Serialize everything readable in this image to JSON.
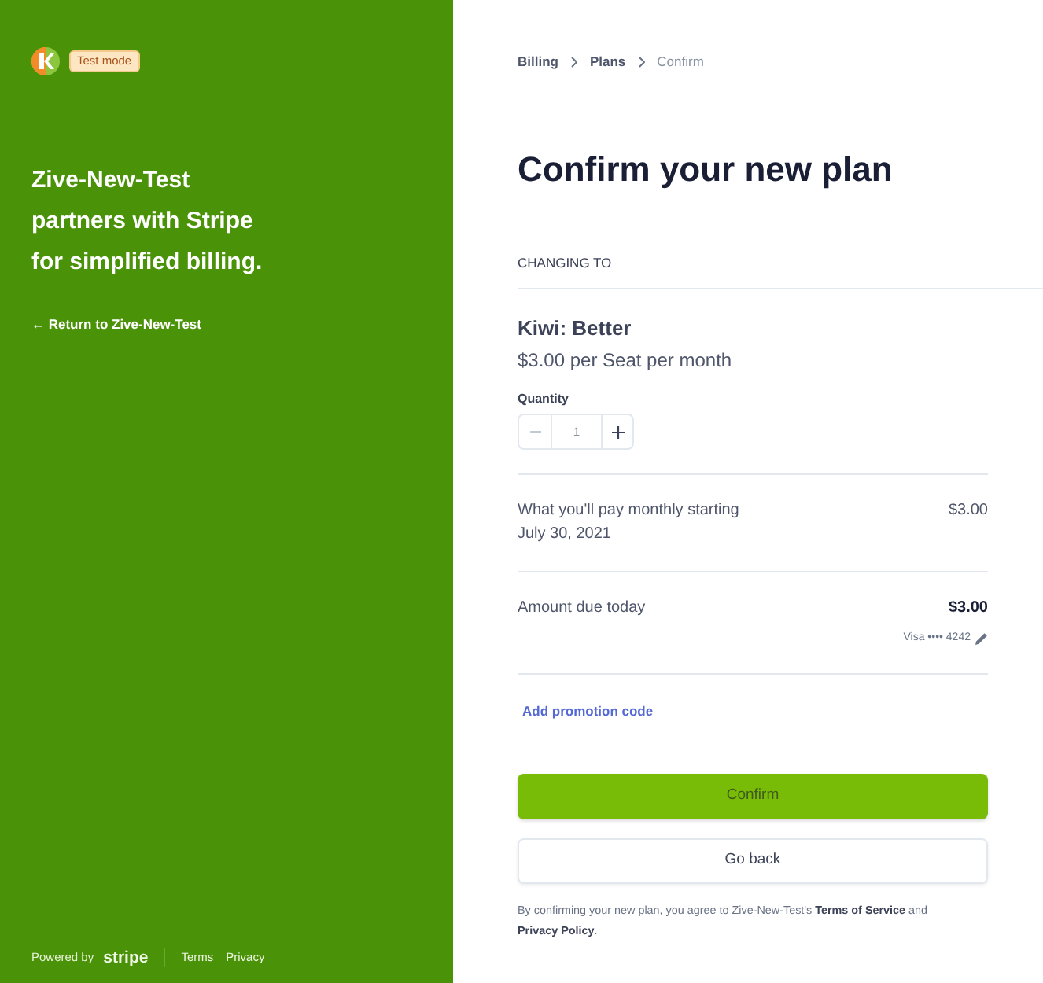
{
  "sidebar": {
    "badge": "Test mode",
    "headline": "Zive-New-Test\npartners with Stripe\nfor simplified billing.",
    "return_link": "← Return to Zive-New-Test",
    "footer": {
      "powered_by": "Powered by",
      "stripe": "stripe",
      "links": [
        "Terms",
        "Privacy"
      ]
    }
  },
  "breadcrumb": [
    {
      "label": "Billing",
      "current": false
    },
    {
      "label": "Plans",
      "current": false
    },
    {
      "label": "Confirm",
      "current": true
    }
  ],
  "title": "Confirm your new plan",
  "section_label": "CHANGING TO",
  "plan": {
    "name": "Kiwi: Better",
    "price": "$3.00 per Seat per month",
    "quantity_label": "Quantity",
    "quantity": "1",
    "decrement_disabled": true
  },
  "recurring": {
    "label": "What you'll pay monthly starting",
    "date": "July 30, 2021",
    "amount": "$3.00"
  },
  "due_today": {
    "label": "Amount due today",
    "amount": "$3.00",
    "payment_method": "Visa •••• 4242"
  },
  "promo_link": "Add promotion code",
  "buttons": [
    {
      "label": "Confirm",
      "kind": "primary"
    },
    {
      "label": "Go back",
      "kind": "secondary"
    }
  ],
  "legal": {
    "before": "By confirming your new plan, you agree to Zive-New-Test's ",
    "terms_link": "Terms of Service",
    "middle": " and ",
    "privacy_link": "Privacy Policy",
    "after": "."
  }
}
